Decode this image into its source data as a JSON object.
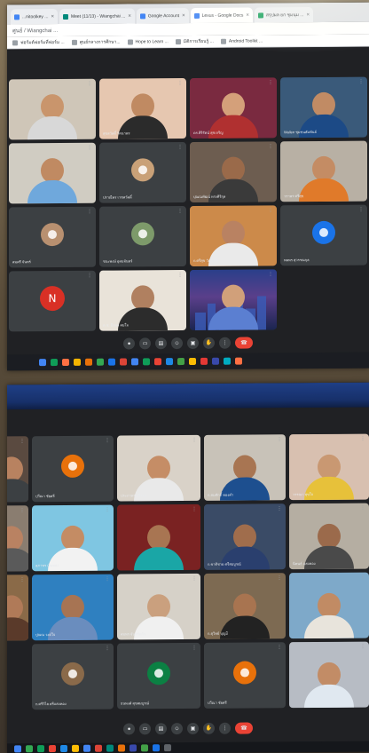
{
  "top_window": {
    "tabs": [
      {
        "label": "...nitoolkey ...",
        "color": "#4285f4",
        "active": false
      },
      {
        "label": "Meet (11/13) - Wiangchai ...",
        "color": "#00897b",
        "active": false
      },
      {
        "label": "Google Account",
        "color": "#4285f4",
        "active": false
      },
      {
        "label": "Lexus - Google Docs",
        "color": "#4285f4",
        "active": true
      },
      {
        "label": "สรุปผล ยก ชุมนุม ...",
        "color": "#0f9d58",
        "active": false
      }
    ],
    "address": "ศูนย์ / Wiangchai ...",
    "bookmarks": [
      "ฟอร์มต์ฟอร์มที่ฟอร์ม ...",
      "ศูนย์กลางการศึกษา...",
      "Hope to Learn ...",
      "มิติการเรียนรู้ ...",
      "Android Toolkit ..."
    ],
    "tiles": [
      {
        "kind": "person",
        "label": "",
        "skin": "#c9956c",
        "shirt": "#d8d8d8",
        "bg": "#cfc6b8"
      },
      {
        "kind": "person",
        "label": "สุขสวัสดิ์ รัตนาพร",
        "skin": "#c08a62",
        "shirt": "#2b2b2b",
        "bg": "#e6c7b0"
      },
      {
        "kind": "person",
        "label": "ดร.ศิริรัตน์ สุขเจริญ",
        "skin": "#d4a07a",
        "shirt": "#b03030",
        "bg": "#7a2a40"
      },
      {
        "kind": "person",
        "label": "Wallee ชุมชนสัมพันธ์",
        "skin": "#c18b64",
        "shirt": "#1c4a86",
        "bg": "#3a5a7a"
      },
      {
        "kind": "person",
        "label": "",
        "skin": "#c08a62",
        "shirt": "#6fa8dc",
        "bg": "#d0ccc2"
      },
      {
        "kind": "avatar",
        "label": "ปราณีพร เวชสวัสดิ์",
        "avatar_text": "",
        "avatar_bg": "#c9a178"
      },
      {
        "kind": "person",
        "label": "ปุณณพัฒน์ ทรงศิริกุล",
        "skin": "#9a6a4a",
        "shirt": "#3a3a3a",
        "bg": "#6d5d50"
      },
      {
        "kind": "person",
        "label": "วราพร ศรีสุข",
        "skin": "#c48c64",
        "shirt": "#e07a2a",
        "bg": "#b8b0a4"
      },
      {
        "kind": "avatar",
        "label": "สมศรี จันทร์",
        "avatar_text": "",
        "avatar_bg": "#b89070"
      },
      {
        "kind": "avatar",
        "label": "ชนะพงษ์ อุดมจันทร์",
        "avatar_text": "",
        "avatar_bg": "#7d9a6a"
      },
      {
        "kind": "person",
        "label": "ก.ศรีสุข วัฒนศิริ",
        "skin": "#b98262",
        "shirt": "#eaeaea",
        "bg": "#cc8a4a"
      },
      {
        "kind": "avatar",
        "label": "พลพร สุวรรณกุล",
        "avatar_text": "",
        "avatar_bg": "#1a73e8"
      },
      {
        "kind": "avatar",
        "label": "",
        "avatar_text": "N",
        "avatar_bg": "#d93025"
      },
      {
        "kind": "person",
        "label": "ด.ช. ธีรพล สมใจ",
        "skin": "#b08060",
        "shirt": "#2c2c2c",
        "bg": "#e9e3d9"
      },
      {
        "kind": "city",
        "label": "",
        "skin": "#d1a07a",
        "shirt": "#5b7fd1",
        "bg": "#1c2e6a"
      }
    ],
    "taskbar_colors": [
      "#4285f4",
      "#0f9d58",
      "#ff7043",
      "#f4b400",
      "#e8710a",
      "#34a853",
      "#1a73e8",
      "#db4437",
      "#4285f4",
      "#0f9d58",
      "#ea4335",
      "#1e88e5",
      "#43a047",
      "#fbbc04",
      "#e53935",
      "#3949ab",
      "#00acc1",
      "#ff7043"
    ]
  },
  "bottom_window": {
    "tiles": [
      {
        "kind": "person",
        "label": "",
        "skin": "#b88260",
        "shirt": "#3c4043",
        "bg": "#5a4a40"
      },
      {
        "kind": "avatar",
        "label": "ปวีณา ชัยศรี",
        "avatar_text": "",
        "avatar_bg": "#e8710a"
      },
      {
        "kind": "person",
        "label": "ประภาพร ศรีวงศ์",
        "skin": "#c58d66",
        "shirt": "#e9e9e9",
        "bg": "#d9d2c8"
      },
      {
        "kind": "person",
        "label": "ก.สมศักดิ์ ทองคำ",
        "skin": "#a87552",
        "shirt": "#1d4f8f",
        "bg": "#c8c2b8"
      },
      {
        "kind": "person",
        "label": "วรรณา สุขใจ",
        "skin": "#c99872",
        "shirt": "#e7c13a",
        "bg": "#d8c0b0"
      },
      {
        "kind": "person",
        "label": "",
        "skin": "#b98262",
        "shirt": "#5a5a5a",
        "bg": "#8a7d70"
      },
      {
        "kind": "person",
        "label": "สุภาพร เงินทอง",
        "skin": "#c48c64",
        "shirt": "#f2f2f2",
        "bg": "#7fc6e2"
      },
      {
        "kind": "person",
        "label": "",
        "skin": "#a87552",
        "shirt": "#1aa6a6",
        "bg": "#7a2222"
      },
      {
        "kind": "person",
        "label": "ก.ชาติชาย ศรีสมบูรณ์",
        "skin": "#a06d4c",
        "shirt": "#2a3f6e",
        "bg": "#3a4b66"
      },
      {
        "kind": "person",
        "label": "นิพนธ์ แสงทอง",
        "skin": "#9b6a4b",
        "shirt": "#4a4a4a",
        "bg": "#b5aea2"
      },
      {
        "kind": "person",
        "label": "",
        "skin": "#b07a58",
        "shirt": "#5a3a2a",
        "bg": "#8a6a48"
      },
      {
        "kind": "person",
        "label": "ปุณณ วงค์ใจ",
        "skin": "#a77453",
        "shirt": "#6a8dbe",
        "bg": "#2f80c0"
      },
      {
        "kind": "person",
        "label": "สมพร จันทร์แก้ว",
        "skin": "#caa07e",
        "shirt": "#f0f0f0",
        "bg": "#d6d1c8"
      },
      {
        "kind": "person",
        "label": "ก.สุวิทย์ บุญมี",
        "skin": "#a87450",
        "shirt": "#222222",
        "bg": "#7d6a52"
      },
      {
        "kind": "person",
        "label": "",
        "skin": "#c18b64",
        "shirt": "#e8e4dc",
        "bg": "#7ea9c9"
      },
      {
        "kind": "empty",
        "label": ""
      },
      {
        "kind": "avatar",
        "label": "ก.ศรีวิไล ศรีแสงทอง",
        "avatar_text": "",
        "avatar_bg": "#8a6a4a"
      },
      {
        "kind": "avatar",
        "label": "ธนพงศ์ สุขสมบูรณ์",
        "avatar_text": "",
        "avatar_bg": "#0b8043"
      },
      {
        "kind": "avatar",
        "label": "ปวีณา ชัยศรี",
        "avatar_text": "",
        "avatar_bg": "#e8710a"
      },
      {
        "kind": "person",
        "label": "",
        "skin": "#c28c66",
        "shirt": "#e0e8f0",
        "bg": "#b7bcc4"
      }
    ],
    "taskbar_colors": [
      "#4285f4",
      "#34a853",
      "#0f9d58",
      "#ea4335",
      "#1e88e5",
      "#fbbc04",
      "#4285f4",
      "#db4437",
      "#00897b",
      "#e8710a",
      "#3949ab",
      "#43a047",
      "#1a73e8",
      "#5f6368"
    ]
  }
}
